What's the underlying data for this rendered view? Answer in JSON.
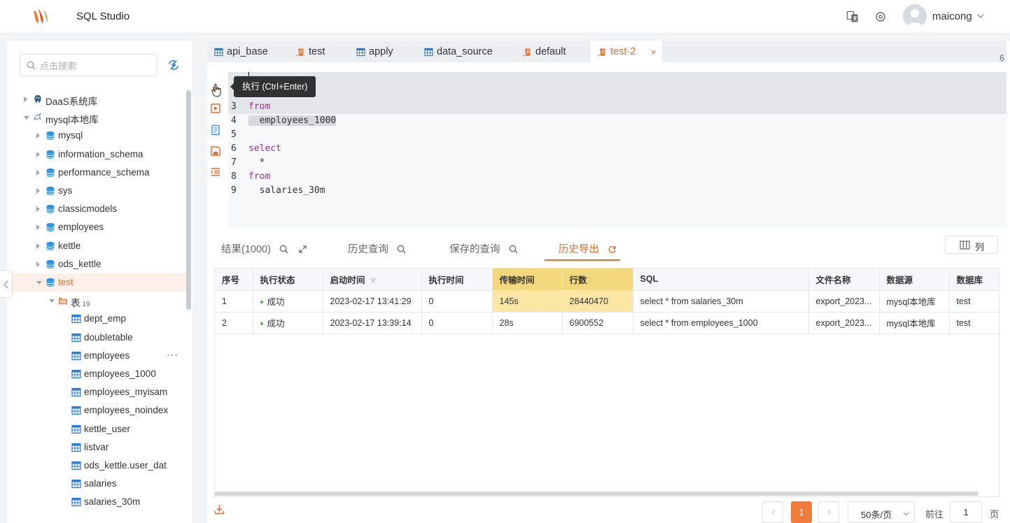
{
  "app": {
    "title": "SQL Studio",
    "username": "maicong"
  },
  "colors": {
    "accent": "#ea6a2f",
    "success": "#3fb950",
    "highlight": "#f3d77c"
  },
  "sidebar": {
    "search_placeholder": "点击搜索",
    "tree": [
      {
        "label": "DaaS系统库",
        "icon": "postgres-icon",
        "level": 0,
        "expanded": false
      },
      {
        "label": "mysql本地库",
        "icon": "mysql-dolphin-icon",
        "level": 0,
        "expanded": true
      },
      {
        "label": "mysql",
        "icon": "database-icon",
        "level": 1
      },
      {
        "label": "information_schema",
        "icon": "database-icon",
        "level": 1
      },
      {
        "label": "performance_schema",
        "icon": "database-icon",
        "level": 1
      },
      {
        "label": "sys",
        "icon": "database-icon",
        "level": 1
      },
      {
        "label": "classicmodels",
        "icon": "database-icon",
        "level": 1
      },
      {
        "label": "employees",
        "icon": "database-icon",
        "level": 1
      },
      {
        "label": "kettle",
        "icon": "database-icon",
        "level": 1
      },
      {
        "label": "ods_kettle",
        "icon": "database-icon",
        "level": 1
      },
      {
        "label": "test",
        "icon": "database-icon",
        "level": 1,
        "expanded": true,
        "selected": true
      },
      {
        "label": "表",
        "icon": "folder-icon",
        "level": 2,
        "expanded": true,
        "count": "19"
      },
      {
        "label": "dept_emp",
        "icon": "table-icon",
        "level": 3
      },
      {
        "label": "doubletable",
        "icon": "table-icon",
        "level": 3
      },
      {
        "label": "employees",
        "icon": "table-icon",
        "level": 3,
        "more": "···"
      },
      {
        "label": "employees_1000",
        "icon": "table-icon",
        "level": 3
      },
      {
        "label": "employees_myisam",
        "icon": "table-icon",
        "level": 3
      },
      {
        "label": "employees_noindex",
        "icon": "table-icon",
        "level": 3
      },
      {
        "label": "kettle_user",
        "icon": "table-icon",
        "level": 3
      },
      {
        "label": "listvar",
        "icon": "table-icon",
        "level": 3
      },
      {
        "label": "ods_kettle.user_dat",
        "icon": "table-icon",
        "level": 3
      },
      {
        "label": "salaries",
        "icon": "table-icon",
        "level": 3
      },
      {
        "label": "salaries_30m",
        "icon": "table-icon",
        "level": 3
      }
    ]
  },
  "editor_tabs": [
    {
      "label": "api_base",
      "icon": "table-icon"
    },
    {
      "label": "test",
      "icon": "script-icon"
    },
    {
      "label": "apply",
      "icon": "table-icon"
    },
    {
      "label": "data_source",
      "icon": "table-icon"
    },
    {
      "label": "default",
      "icon": "script-icon"
    },
    {
      "label": "test-2",
      "icon": "script-icon",
      "active": true,
      "close": "×"
    }
  ],
  "tab_overflow": "6",
  "tooltip": "执行 (Ctrl+Enter)",
  "editor": {
    "lines": [
      {
        "n": "3",
        "text": "from",
        "type": "keyword"
      },
      {
        "n": "4",
        "text": "  employees_1000",
        "type": "selected"
      },
      {
        "n": "5",
        "text": "",
        "type": "plain"
      },
      {
        "n": "6",
        "text": "select",
        "type": "keyword"
      },
      {
        "n": "7",
        "text": "  *",
        "type": "plain"
      },
      {
        "n": "8",
        "text": "from",
        "type": "keyword"
      },
      {
        "n": "9",
        "text": "  salaries_30m",
        "type": "plain"
      }
    ]
  },
  "result_tabs": {
    "results": "结果(1000)",
    "history_query": "历史查询",
    "saved_query": "保存的查询",
    "history_export": "历史导出"
  },
  "columns_button": "列",
  "table": {
    "headers": [
      "序号",
      "执行状态",
      "启动时间",
      "执行时间",
      "传输时间",
      "行数",
      "SQL",
      "文件名称",
      "数据源",
      "数据库"
    ],
    "rows": [
      [
        "1",
        "成功",
        "2023-02-17 13:41:29",
        "0",
        "145s",
        "28440470",
        "select * from salaries_30m",
        "export_2023...",
        "mysql本地库",
        "test"
      ],
      [
        "2",
        "成功",
        "2023-02-17 13:39:14",
        "0",
        "28s",
        "6900552",
        "select * from employees_1000",
        "export_2023...",
        "mysql本地库",
        "test"
      ]
    ]
  },
  "pagination": {
    "current": "1",
    "page_size": "50条/页",
    "goto_label": "前往",
    "goto_value": "1",
    "page_unit": "页"
  }
}
